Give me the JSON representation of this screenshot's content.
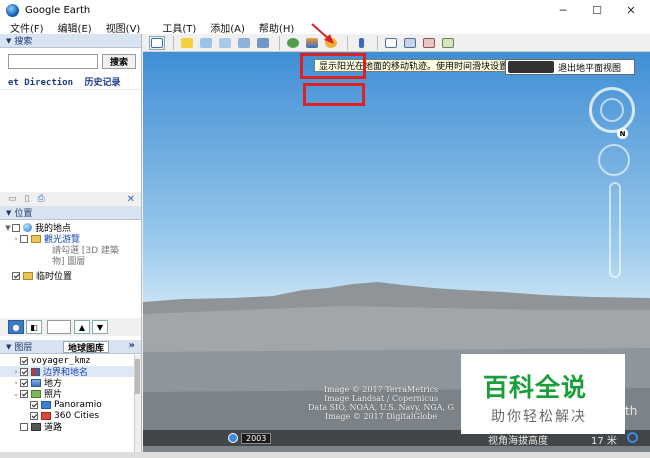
{
  "window": {
    "title": "Google Earth",
    "minimize_glyph": "─",
    "maximize_glyph": "☐",
    "close_glyph": "✕"
  },
  "menu": [
    "文件(F)",
    "编辑(E)",
    "视图(V)",
    "工具(T)",
    "添加(A)",
    "帮助(H)"
  ],
  "search": {
    "header": "搜索",
    "input_value": "",
    "button": "搜索",
    "tab_directions": "et Direction",
    "tab_history": "历史记录"
  },
  "places": {
    "header": "位置",
    "items": [
      {
        "label": "我的地点"
      },
      {
        "label": "觀光游覽",
        "sub1": "請勾選 [3D 建築",
        "sub2": "物] 圖層"
      },
      {
        "label": "临时位置"
      }
    ]
  },
  "layers": {
    "header": "图层",
    "gallery_button": "地球图库",
    "gallery_arrow": "»",
    "items": [
      {
        "label": "voyager_kmz"
      },
      {
        "label": "边界和地名"
      },
      {
        "label": "地方"
      },
      {
        "label": "照片"
      },
      {
        "label": "Panoramio"
      },
      {
        "label": "360 Cities"
      },
      {
        "label": "道路"
      }
    ]
  },
  "toolbar": {
    "tooltip": "显示阳光在地面的移动轨迹。使用时间滑块设置时间。",
    "exit_ground_view": "退出地平面视图"
  },
  "map": {
    "attribution": [
      "Image © 2017 TerraMetrics",
      "Image Landsat / Copernicus",
      "Data SIO, NOAA, U.S. Navy, NGA, G",
      "Image © 2017 DigitalGlobe"
    ],
    "year": "2003",
    "status_view": "视角海拔高度",
    "status_alt": "17 米",
    "compass_north": "N",
    "earth_partial": "th"
  },
  "watermark": {
    "title": "百科全说",
    "subtitle": "助你轻松解决"
  },
  "colors": {
    "highlight": "#e02020",
    "watermark_green": "#1a9e3a"
  }
}
